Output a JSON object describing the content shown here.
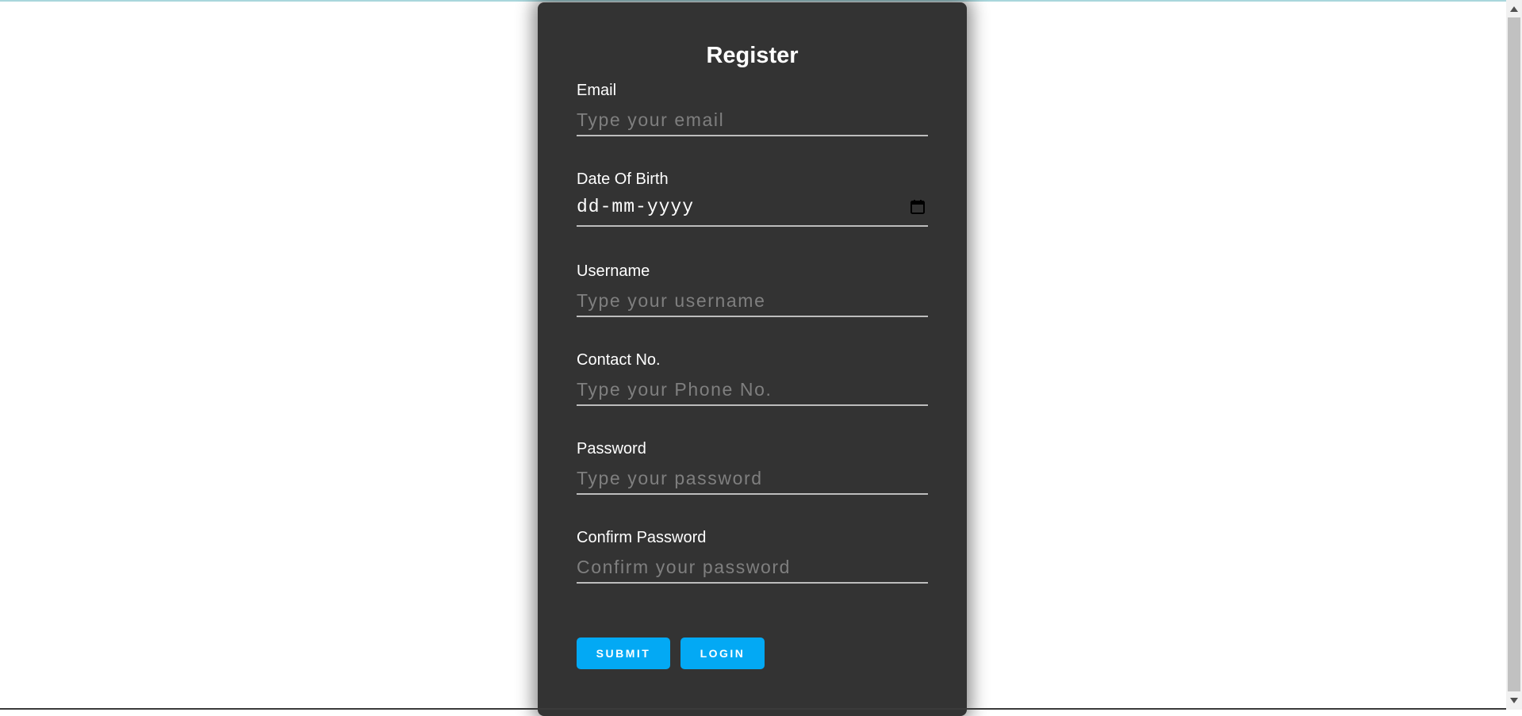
{
  "form": {
    "title": "Register",
    "fields": [
      {
        "label": "Email",
        "placeholder": "Type your email",
        "type": "email"
      },
      {
        "label": "Date Of Birth",
        "value": "dd-mm-yyyy",
        "type": "date"
      },
      {
        "label": "Username",
        "placeholder": "Type your username",
        "type": "text"
      },
      {
        "label": "Contact No.",
        "placeholder": "Type your Phone No.",
        "type": "tel"
      },
      {
        "label": "Password",
        "placeholder": "Type your password",
        "type": "password"
      },
      {
        "label": "Confirm Password",
        "placeholder": "Confirm your password",
        "type": "password"
      }
    ],
    "buttons": {
      "submit": "SUBMIT",
      "login": "LOGIN"
    }
  },
  "icons": {
    "date_picker": "calendar-icon",
    "scroll_up": "scroll-up-arrow-icon",
    "scroll_down": "scroll-down-arrow-icon"
  },
  "colors": {
    "card_background": "#333333",
    "button_accent": "#03a9f4",
    "placeholder_text": "#7f7f7f",
    "underline": "#bdbdbd"
  }
}
